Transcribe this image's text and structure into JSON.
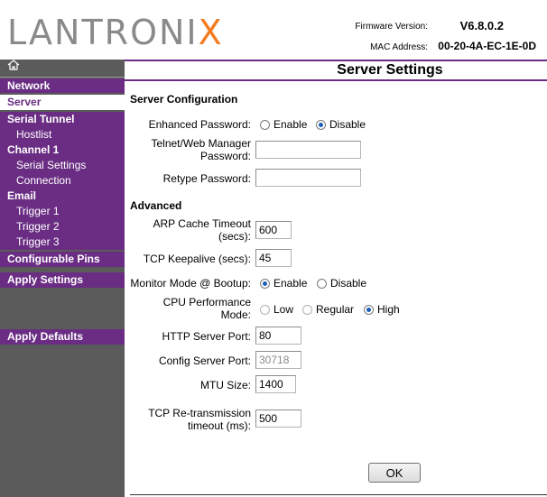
{
  "header": {
    "logo_main": "LANTRONI",
    "logo_x": "X",
    "firmware_label": "Firmware Version:",
    "firmware_value": "V6.8.0.2",
    "mac_label": "MAC Address:",
    "mac_value": "00-20-4A-EC-1E-0D"
  },
  "sidebar": {
    "home_icon": "home-icon",
    "network": "Network",
    "server": "Server",
    "serial_tunnel": "Serial Tunnel",
    "hostlist": "Hostlist",
    "channel1": "Channel 1",
    "serial_settings": "Serial Settings",
    "connection": "Connection",
    "email": "Email",
    "trigger1": "Trigger 1",
    "trigger2": "Trigger 2",
    "trigger3": "Trigger 3",
    "configurable_pins": "Configurable Pins",
    "apply_settings": "Apply Settings",
    "apply_defaults": "Apply Defaults"
  },
  "main": {
    "title": "Server Settings",
    "server_config_heading": "Server Configuration",
    "enhanced_password_label": "Enhanced Password:",
    "enable": "Enable",
    "disable": "Disable",
    "telnet_label_1": "Telnet/Web Manager",
    "telnet_label_2": "Password:",
    "retype_label": "Retype Password:",
    "advanced_heading": "Advanced",
    "arp_label_1": "ARP Cache Timeout",
    "arp_label_2": "(secs):",
    "arp_value": "600",
    "tcp_keepalive_label": "TCP Keepalive (secs):",
    "tcp_keepalive_value": "45",
    "monitor_mode_label": "Monitor Mode @ Bootup:",
    "cpu_label_1": "CPU Performance",
    "cpu_label_2": "Mode:",
    "low": "Low",
    "regular": "Regular",
    "high": "High",
    "http_port_label": "HTTP Server Port:",
    "http_port_value": "80",
    "config_port_label": "Config Server Port:",
    "config_port_value": "30718",
    "mtu_label": "MTU Size:",
    "mtu_value": "1400",
    "retrans_label_1": "TCP Re-transmission",
    "retrans_label_2": "timeout (ms):",
    "retrans_value": "500",
    "ok_label": "OK"
  },
  "colors": {
    "purple": "#6a2d83",
    "sidebar_gray": "#5b5b5b",
    "logo_orange": "#f47b20"
  }
}
